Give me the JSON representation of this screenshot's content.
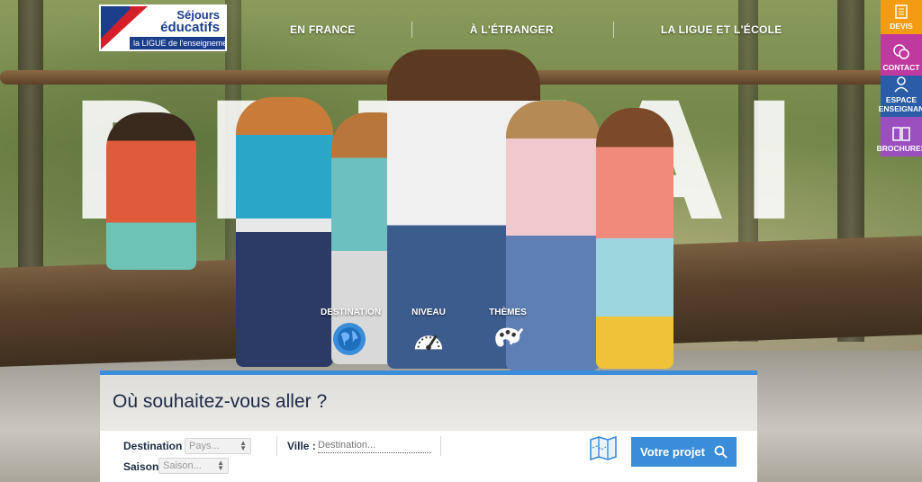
{
  "brand": {
    "line1": "Séjours",
    "line2": "éducatifs",
    "tagline": "la LIGUE de l'enseignement",
    "colors": {
      "red": "#d41f2a",
      "blue": "#1b3e8c"
    }
  },
  "nav": {
    "items": [
      {
        "label": "EN FRANCE"
      },
      {
        "label": "À L'ÉTRANGER"
      },
      {
        "label": "LA LIGUE ET L'ÉCOLE"
      }
    ]
  },
  "side_tabs": [
    {
      "label": "DEVIS",
      "icon": "document-icon",
      "color": "#f39c12"
    },
    {
      "label": "CONTACT",
      "icon": "chat-bubbles-icon",
      "color": "#c0399e"
    },
    {
      "label": "ESPACE ENSEIGNAN",
      "icon": "teacher-icon",
      "color": "#2a5ca8"
    },
    {
      "label": "BROCHURES",
      "icon": "brochure-icon",
      "color": "#9b4fbf"
    }
  ],
  "hero": {
    "big_word": "PRIMAIRE"
  },
  "categories": [
    {
      "label": "DESTINATION",
      "icon": "globe-icon",
      "active": true
    },
    {
      "label": "NIVEAU",
      "icon": "gauge-icon",
      "active": false
    },
    {
      "label": "THÈMES",
      "icon": "palette-icon",
      "active": false
    }
  ],
  "search": {
    "title": "Où souhaitez-vous aller ?",
    "destination_label": "Destination :",
    "destination_value": "Pays...",
    "city_label": "Ville :",
    "city_placeholder": "Destination...",
    "season_label": "Saison :",
    "season_value": "Saison...",
    "submit_label": "Votre projet",
    "accent": "#3a8dd9"
  }
}
